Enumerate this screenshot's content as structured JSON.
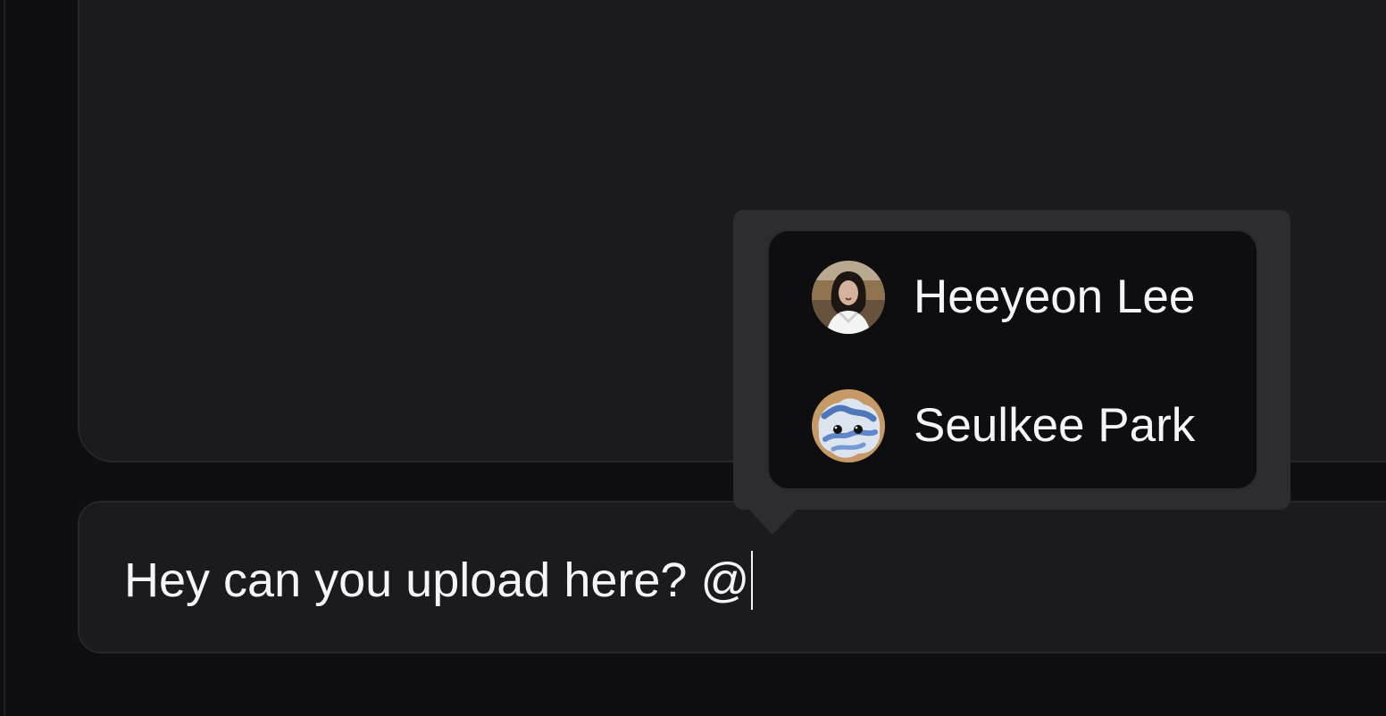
{
  "composer": {
    "text": "Hey can you upload here? @"
  },
  "mentions": {
    "items": [
      {
        "name": "Heeyeon Lee",
        "avatar_icon": "person-photo-avatar"
      },
      {
        "name": "Seulkee Park",
        "avatar_icon": "fuzzy-creature-avatar"
      }
    ]
  },
  "colors": {
    "background": "#0f0f11",
    "panel": "#1a1a1f",
    "popover": "#2d2d30",
    "list": "#0e0e10",
    "text": "#f5f5f7"
  }
}
